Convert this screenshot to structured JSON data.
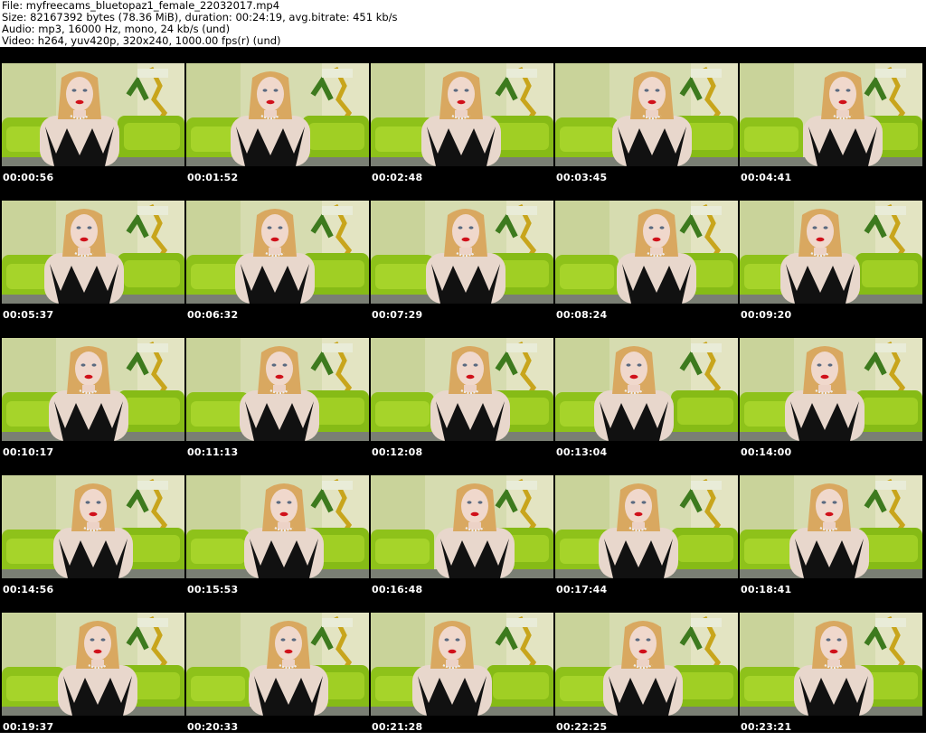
{
  "header": {
    "file_line": "File: myfreecams_bluetopaz1_female_22032017.mp4",
    "size_line": "Size: 82167392 bytes (78.36 MiB), duration: 00:24:19, avg.bitrate: 451 kb/s",
    "audio_line": "Audio: mp3, 16000 Hz, mono, 24 kb/s (und)",
    "video_line": "Video: h264, yuv420p, 320x240, 1000.00 fps(r) (und)"
  },
  "frames": [
    {
      "timestamp": "00:00:56"
    },
    {
      "timestamp": "00:01:52"
    },
    {
      "timestamp": "00:02:48"
    },
    {
      "timestamp": "00:03:45"
    },
    {
      "timestamp": "00:04:41"
    },
    {
      "timestamp": "00:05:37"
    },
    {
      "timestamp": "00:06:32"
    },
    {
      "timestamp": "00:07:29"
    },
    {
      "timestamp": "00:08:24"
    },
    {
      "timestamp": "00:09:20"
    },
    {
      "timestamp": "00:10:17"
    },
    {
      "timestamp": "00:11:13"
    },
    {
      "timestamp": "00:12:08"
    },
    {
      "timestamp": "00:13:04"
    },
    {
      "timestamp": "00:14:00"
    },
    {
      "timestamp": "00:14:56"
    },
    {
      "timestamp": "00:15:53"
    },
    {
      "timestamp": "00:16:48"
    },
    {
      "timestamp": "00:17:44"
    },
    {
      "timestamp": "00:18:41"
    },
    {
      "timestamp": "00:19:37"
    },
    {
      "timestamp": "00:20:33"
    },
    {
      "timestamp": "00:21:28"
    },
    {
      "timestamp": "00:22:25"
    },
    {
      "timestamp": "00:23:21"
    }
  ],
  "colors": {
    "sheet_background": "#000000",
    "timestamp_text": "#ffffff",
    "header_text": "#000000"
  }
}
